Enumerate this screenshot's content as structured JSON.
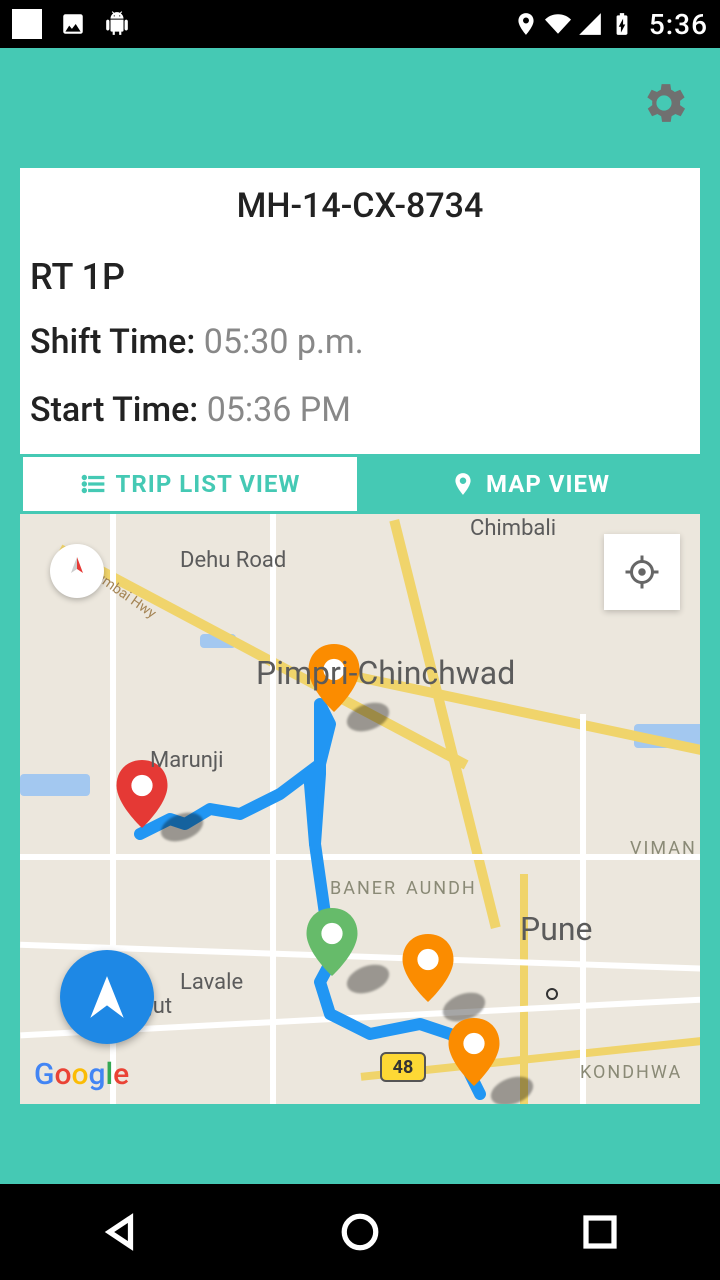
{
  "status": {
    "time": "5:36"
  },
  "header": {
    "vehicle_plate": "MH-14-CX-8734",
    "route_name": "RT 1P",
    "shift_label": "Shift Time: ",
    "shift_value": "05:30 p.m.",
    "start_label": "Start Time: ",
    "start_value": "05:36 PM"
  },
  "tabs": {
    "list_label": "TRIP LIST VIEW",
    "map_label": "MAP VIEW",
    "active": "map"
  },
  "map": {
    "labels": {
      "chimbali": "Chimbali",
      "dehu": "Dehu Road",
      "mumbai_hwy": "Mumbai Hwy",
      "pimpri": "Pimpri-Chinchwad",
      "marunji": "Marunji",
      "baner": "BANER",
      "aundh": "AUNDH",
      "pune": "Pune",
      "viman": "VIMAN N",
      "lavale": "Lavale",
      "pirangut": "Pirangut",
      "kondhwa": "KONDHWA",
      "hwy48": "48"
    },
    "attribution": "Google"
  }
}
